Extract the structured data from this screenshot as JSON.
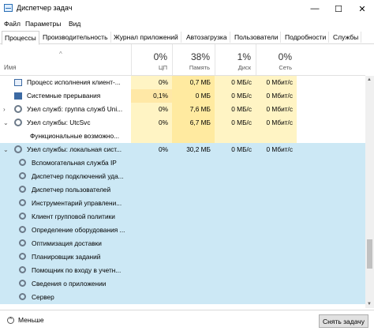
{
  "window": {
    "title": "Диспетчер задач",
    "minimize": "—",
    "maximize": "☐",
    "close": "✕"
  },
  "menu": [
    "Файл",
    "Параметры",
    "Вид"
  ],
  "tabs": [
    "Процессы",
    "Производительность",
    "Журнал приложений",
    "Автозагрузка",
    "Пользователи",
    "Подробности",
    "Службы"
  ],
  "active_tab": "Процессы",
  "columns": {
    "name": "Имя",
    "sort_arrow": "^",
    "cpu": {
      "pct": "0%",
      "label": "ЦП"
    },
    "mem": {
      "pct": "38%",
      "label": "Память"
    },
    "disk": {
      "pct": "1%",
      "label": "Диск"
    },
    "net": {
      "pct": "0%",
      "label": "Сеть"
    }
  },
  "rows": [
    {
      "name": "Процесс исполнения клиент-...",
      "cpu": "0%",
      "mem": "0,7 МБ",
      "disk": "0 МБ/с",
      "net": "0 Мбит/с",
      "icon": "window-icon",
      "level": 0,
      "expander": ""
    },
    {
      "name": "Системные прерывания",
      "cpu": "0,1%",
      "mem": "0 МБ",
      "disk": "0 МБ/с",
      "net": "0 Мбит/с",
      "icon": "system-icon",
      "level": 0,
      "expander": ""
    },
    {
      "name": "Узел служб: группа служб Uni...",
      "cpu": "0%",
      "mem": "7,6 МБ",
      "disk": "0 МБ/с",
      "net": "0 Мбит/с",
      "icon": "gear-icon",
      "level": 0,
      "expander": "›"
    },
    {
      "name": "Узел службы: UtcSvc",
      "cpu": "0%",
      "mem": "6,7 МБ",
      "disk": "0 МБ/с",
      "net": "0 Мбит/с",
      "icon": "gear-icon",
      "level": 0,
      "expander": "⌄"
    },
    {
      "name": "Функциональные возможно...",
      "cpu": "",
      "mem": "",
      "disk": "",
      "net": "",
      "icon": "",
      "level": 1,
      "expander": ""
    },
    {
      "name": "Узел службы: локальная сист...",
      "cpu": "0%",
      "mem": "30,2 МБ",
      "disk": "0 МБ/с",
      "net": "0 Мбит/с",
      "icon": "gear-icon",
      "level": 0,
      "expander": "⌄"
    },
    {
      "name": "Вспомогательная служба IP",
      "cpu": "",
      "mem": "",
      "disk": "",
      "net": "",
      "icon": "gear-icon",
      "level": 1,
      "expander": ""
    },
    {
      "name": "Диспетчер подключений уда...",
      "cpu": "",
      "mem": "",
      "disk": "",
      "net": "",
      "icon": "gear-icon",
      "level": 1,
      "expander": ""
    },
    {
      "name": "Диспетчер пользователей",
      "cpu": "",
      "mem": "",
      "disk": "",
      "net": "",
      "icon": "gear-icon",
      "level": 1,
      "expander": ""
    },
    {
      "name": "Инструментарий управлени...",
      "cpu": "",
      "mem": "",
      "disk": "",
      "net": "",
      "icon": "gear-icon",
      "level": 1,
      "expander": ""
    },
    {
      "name": "Клиент групповой политики",
      "cpu": "",
      "mem": "",
      "disk": "",
      "net": "",
      "icon": "gear-icon",
      "level": 1,
      "expander": ""
    },
    {
      "name": "Определение оборудования ...",
      "cpu": "",
      "mem": "",
      "disk": "",
      "net": "",
      "icon": "gear-icon",
      "level": 1,
      "expander": ""
    },
    {
      "name": "Оптимизация доставки",
      "cpu": "",
      "mem": "",
      "disk": "",
      "net": "",
      "icon": "gear-icon",
      "level": 1,
      "expander": ""
    },
    {
      "name": "Планировщик заданий",
      "cpu": "",
      "mem": "",
      "disk": "",
      "net": "",
      "icon": "gear-icon",
      "level": 1,
      "expander": ""
    },
    {
      "name": "Помощник по входу в учетн...",
      "cpu": "",
      "mem": "",
      "disk": "",
      "net": "",
      "icon": "gear-icon",
      "level": 1,
      "expander": ""
    },
    {
      "name": "Сведения о приложении",
      "cpu": "",
      "mem": "",
      "disk": "",
      "net": "",
      "icon": "gear-icon",
      "level": 1,
      "expander": ""
    },
    {
      "name": "Сервер",
      "cpu": "",
      "mem": "",
      "disk": "",
      "net": "",
      "icon": "gear-icon",
      "level": 1,
      "expander": ""
    }
  ],
  "selected_group": "Узел службы: локальная сист...",
  "colors": {
    "cpu_heat": "#fff4c4",
    "mem_heat": "#ffeaa0",
    "cpu_heat_hi": "#ffe8a6",
    "selected": "#cce8f5",
    "selected_border": "#99d1ff"
  },
  "footer": {
    "less_label": "Меньше",
    "end_task_label": "Снять задачу"
  }
}
